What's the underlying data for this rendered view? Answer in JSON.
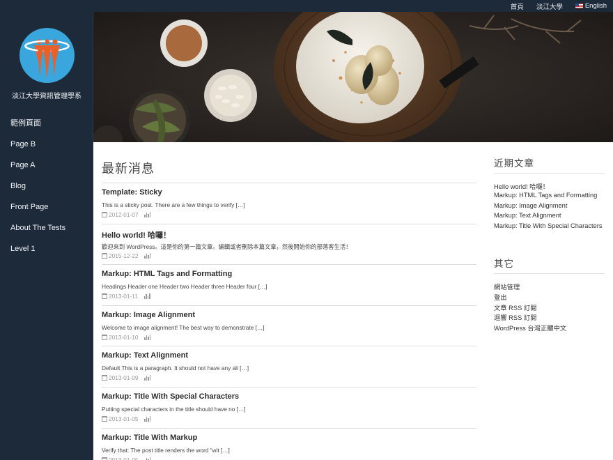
{
  "topnav": {
    "home": "首頁",
    "university": "淡江大學",
    "language": "English"
  },
  "site": {
    "name": "淡江大學資訊管理學系"
  },
  "menu": [
    "範例頁面",
    "Page B",
    "Page A",
    "Blog",
    "Front Page",
    "About The Tests",
    "Level 1"
  ],
  "main": {
    "title": "最新消息",
    "posts": [
      {
        "title": "Template: Sticky",
        "excerpt": "This is a sticky post. There are a few things to verify […]",
        "date": "2012-01-07"
      },
      {
        "title": "Hello world! 哈囉！",
        "excerpt": "歡迎來到 WordPress。這是你的第一篇文章。編輯或者刪除本篇文章，然後開始你的部落客生活！",
        "date": "2015-12-22"
      },
      {
        "title": "Markup: HTML Tags and Formatting",
        "excerpt": "Headings Header one Header two Header three Header four […]",
        "date": "2013-01-11"
      },
      {
        "title": "Markup: Image Alignment",
        "excerpt": "Welcome to image alignment! The best way to demonstrate […]",
        "date": "2013-01-10"
      },
      {
        "title": "Markup: Text Alignment",
        "excerpt": "Default This is a paragraph. It should not have any ali […]",
        "date": "2013-01-09"
      },
      {
        "title": "Markup: Title With Special Characters",
        "excerpt": "Putting special characters in the title should have no […]",
        "date": "2013-01-05"
      },
      {
        "title": "Markup: Title With Markup",
        "excerpt": "Verify that: The post title renders the word “wit […]",
        "date": "2013-01-05"
      }
    ]
  },
  "aside": {
    "recent": {
      "title": "近期文章",
      "items": [
        "Hello world! 哈囉！",
        "Markup: HTML Tags and Formatting",
        "Markup: Image Alignment",
        "Markup: Text Alignment",
        "Markup: Title With Special Characters"
      ]
    },
    "other": {
      "title": "其它",
      "items": [
        "網站管理",
        "登出",
        "文章 RSS 訂閱",
        "迴響 RSS 訂閱",
        "WordPress 台灣正體中文"
      ]
    }
  },
  "colors": {
    "sidebar": "#1c2a3a",
    "logo_bg": "#3aa6de",
    "logo_figure": "#e8602a"
  }
}
